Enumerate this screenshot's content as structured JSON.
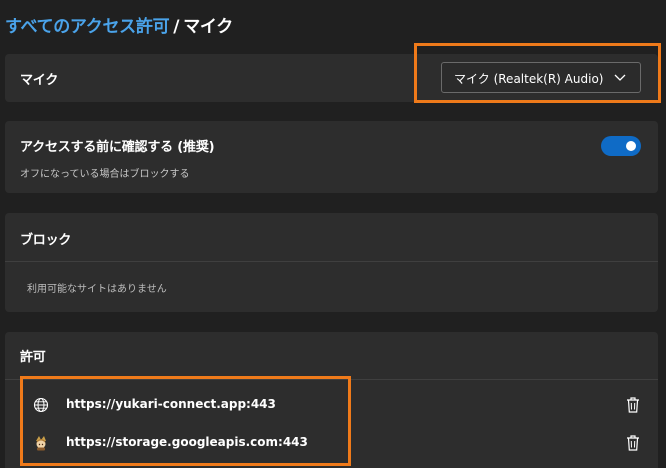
{
  "breadcrumb": {
    "parent": "すべてのアクセス許可",
    "separator": "/",
    "current": "マイク"
  },
  "mic": {
    "title": "マイク",
    "device_selected": "マイク (Realtek(R) Audio)"
  },
  "ask": {
    "title": "アクセスする前に確認する (推奨)",
    "subtitle": "オフになっている場合はブロックする",
    "enabled": true
  },
  "block": {
    "title": "ブロック",
    "empty": "利用可能なサイトはありません"
  },
  "allow": {
    "title": "許可",
    "sites": [
      {
        "url": "https://yukari-connect.app:443",
        "icon": "globe-icon"
      },
      {
        "url": "https://storage.googleapis.com:443",
        "icon": "character-favicon-icon"
      }
    ]
  },
  "colors": {
    "background": "#202020",
    "card": "#2d2d2d",
    "link": "#4aa3ea",
    "toggle_on": "#0f6bc6",
    "highlight": "#ef7a1a"
  }
}
